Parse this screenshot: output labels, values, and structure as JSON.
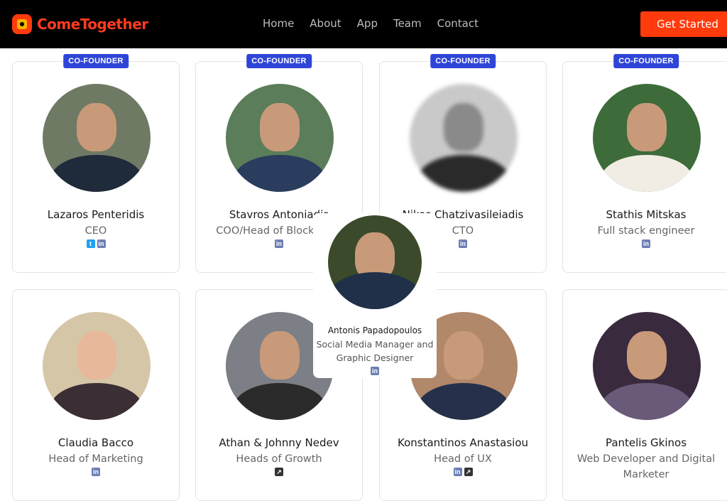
{
  "brand": {
    "name": "ComeTogether",
    "accent": "#ff3a0c",
    "badge_color": "#2f45d8"
  },
  "nav": [
    "Home",
    "About",
    "App",
    "Team",
    "Contact"
  ],
  "cta": "Get Started",
  "team": [
    {
      "name": "Lazaros Penteridis",
      "role": "CEO",
      "badge": "CO-FOUNDER",
      "socials": [
        "twitter-icon",
        "linkedin-icon"
      ],
      "bg": "#6e7a64"
    },
    {
      "name": "Stavros Antoniadis",
      "role": "COO/Head of Blockchain",
      "badge": "CO-FOUNDER",
      "socials": [
        "linkedin-icon"
      ],
      "bg": "#5b7d5a"
    },
    {
      "name": "Nikos Chatzivasileiadis",
      "role": "CTO",
      "badge": "CO-FOUNDER",
      "socials": [
        "linkedin-icon"
      ],
      "bg": "#b9b9b9"
    },
    {
      "name": "Stathis Mitskas",
      "role": "Full stack engineer",
      "badge": "CO-FOUNDER",
      "socials": [
        "linkedin-icon"
      ],
      "bg": "#3d6b3a"
    },
    {
      "name": "Claudia Bacco",
      "role": "Head of Marketing",
      "badge": "",
      "socials": [
        "linkedin-icon"
      ],
      "bg": "#d6c6a8"
    },
    {
      "name": "Athan & Johnny Nedev",
      "role": "Heads of Growth",
      "badge": "",
      "socials": [
        "external-link-icon"
      ],
      "bg": "#7d7f86"
    },
    {
      "name": "Konstantinos Anastasiou",
      "role": "Head of UX",
      "badge": "",
      "socials": [
        "linkedin-icon",
        "external-link-icon"
      ],
      "bg": "#9a7b5a"
    },
    {
      "name": "Pantelis Gkinos",
      "role": "Web Developer and Digital Marketer",
      "badge": "",
      "socials": [],
      "bg": "#3a2a3e"
    }
  ],
  "hover": {
    "name": "Antonis Papadopoulos",
    "role": "Social Media Manager and Graphic Designer",
    "socials": [
      "linkedin-icon"
    ],
    "bg": "#3b4a2a"
  }
}
